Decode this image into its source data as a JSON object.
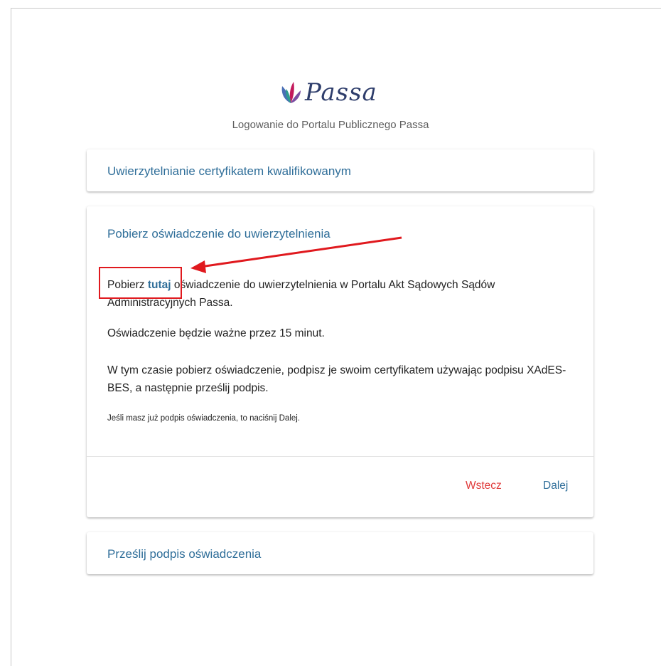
{
  "header": {
    "logo_text": "Passa",
    "subtitle": "Logowanie do Portalu Publicznego Passa"
  },
  "cards": {
    "certificate": {
      "title": "Uwierzytelnianie certyfikatem kwalifikowanym"
    },
    "download": {
      "title": "Pobierz oświadczenie do uwierzytelnienia",
      "p1_prefix": "Pobierz ",
      "p1_link": "tutaj",
      "p1_suffix": " oświadczenie do uwierzytelnienia w Portalu Akt Sądowych Sądów Administracyjnych Passa.",
      "p2": "Oświadczenie będzie ważne przez 15 minut.",
      "p3": "W tym czasie pobierz oświadczenie, podpisz je swoim certyfikatem używając podpisu XAdES-BES, a następnie prześlij podpis.",
      "p4": "Jeśli masz już podpis oświadczenia, to naciśnij Dalej.",
      "back_label": "Wstecz",
      "next_label": "Dalej"
    },
    "upload": {
      "title": "Prześlij podpis oświadczenia"
    }
  },
  "colors": {
    "accent": "#2f6e99",
    "back_button": "#e03a3a",
    "annotation": "#e0191e",
    "logo_text": "#2e3d6b"
  }
}
